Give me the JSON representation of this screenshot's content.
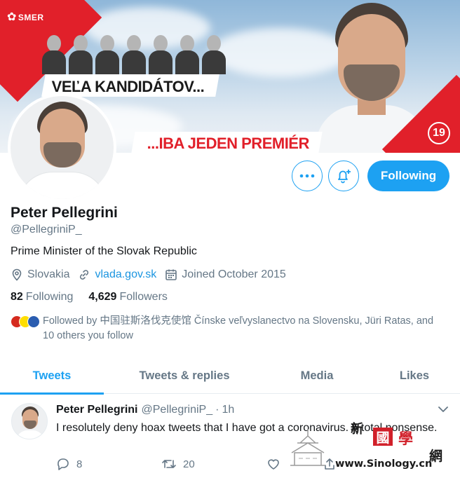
{
  "banner": {
    "party_logo": "SMER",
    "slogan_top": "VEĽA KANDIDÁTOV...",
    "slogan_bottom": "...IBA JEDEN PREMIÉR",
    "list_number": "19",
    "colors": {
      "party_red": "#e1202a",
      "sky": "#bcd4e8"
    }
  },
  "actions": {
    "more_icon": "more-dots-icon",
    "notify_icon": "bell-plus-icon",
    "follow_label": "Following"
  },
  "profile": {
    "name": "Peter Pellegrini",
    "handle": "@PellegriniP_",
    "bio": "Prime Minister of the Slovak Republic",
    "location": "Slovakia",
    "website": "vlada.gov.sk",
    "joined": "Joined October 2015",
    "following_count": "82",
    "following_label": "Following",
    "followers_count": "4,629",
    "followers_label": "Followers",
    "followed_by_line1": "Followed by 中国驻斯洛伐克使馆 Čínske veľvyslanectvo na Slovensku, Jüri Ratas, and",
    "followed_by_line2": "10 others you follow"
  },
  "tabs": [
    {
      "label": "Tweets",
      "active": true
    },
    {
      "label": "Tweets & replies",
      "active": false
    },
    {
      "label": "Media",
      "active": false
    },
    {
      "label": "Likes",
      "active": false
    }
  ],
  "tweet": {
    "author": "Peter Pellegrini",
    "handle": "@PellegriniP_",
    "separator": "·",
    "time": "1h",
    "text": "I resolutely deny hoax tweets that I have got a coronavirus. A total nonsense.",
    "reply_count": "8",
    "retweet_count": "20"
  },
  "watermark": {
    "chars": [
      "新",
      "國",
      "學",
      "網"
    ],
    "site": "www.Sinology.cn"
  },
  "theme": {
    "accent": "#1da1f2",
    "secondary_text": "#657786",
    "link": "#1b95e0"
  }
}
